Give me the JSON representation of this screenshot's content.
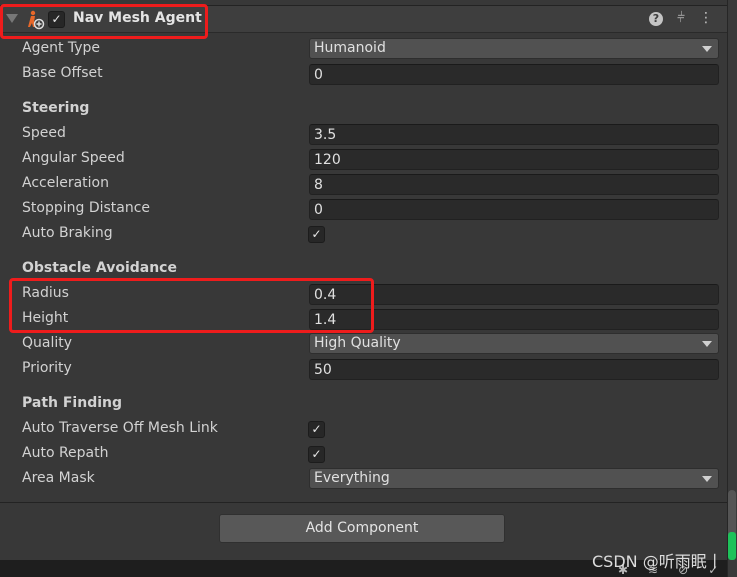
{
  "component": {
    "title": "Nav Mesh Agent",
    "enabled": true
  },
  "fields": [
    {
      "label": "Agent Type",
      "type": "dropdown",
      "value": "Humanoid"
    },
    {
      "label": "Base Offset",
      "type": "text",
      "value": "0"
    }
  ],
  "steering": {
    "title": "Steering",
    "fields": [
      {
        "label": "Speed",
        "value": "3.5"
      },
      {
        "label": "Angular Speed",
        "value": "120"
      },
      {
        "label": "Acceleration",
        "value": "8"
      },
      {
        "label": "Stopping Distance",
        "value": "0"
      },
      {
        "label": "Auto Braking",
        "checked": true
      }
    ]
  },
  "obstacle": {
    "title": "Obstacle Avoidance",
    "fields": [
      {
        "label": "Radius",
        "value": "0.4"
      },
      {
        "label": "Height",
        "value": "1.4"
      },
      {
        "label": "Quality",
        "value": "High Quality"
      },
      {
        "label": "Priority",
        "value": "50"
      }
    ]
  },
  "path": {
    "title": "Path Finding",
    "fields": [
      {
        "label": "Auto Traverse Off Mesh Link",
        "checked": true
      },
      {
        "label": "Auto Repath",
        "checked": true
      },
      {
        "label": "Area Mask",
        "value": "Everything"
      }
    ]
  },
  "add_component": "Add Component",
  "check_glyph": "✓",
  "watermark": "CSDN @听雨眠丨",
  "colors": {
    "highlight": "#ee1c1c",
    "accent": "#1ec25a"
  }
}
